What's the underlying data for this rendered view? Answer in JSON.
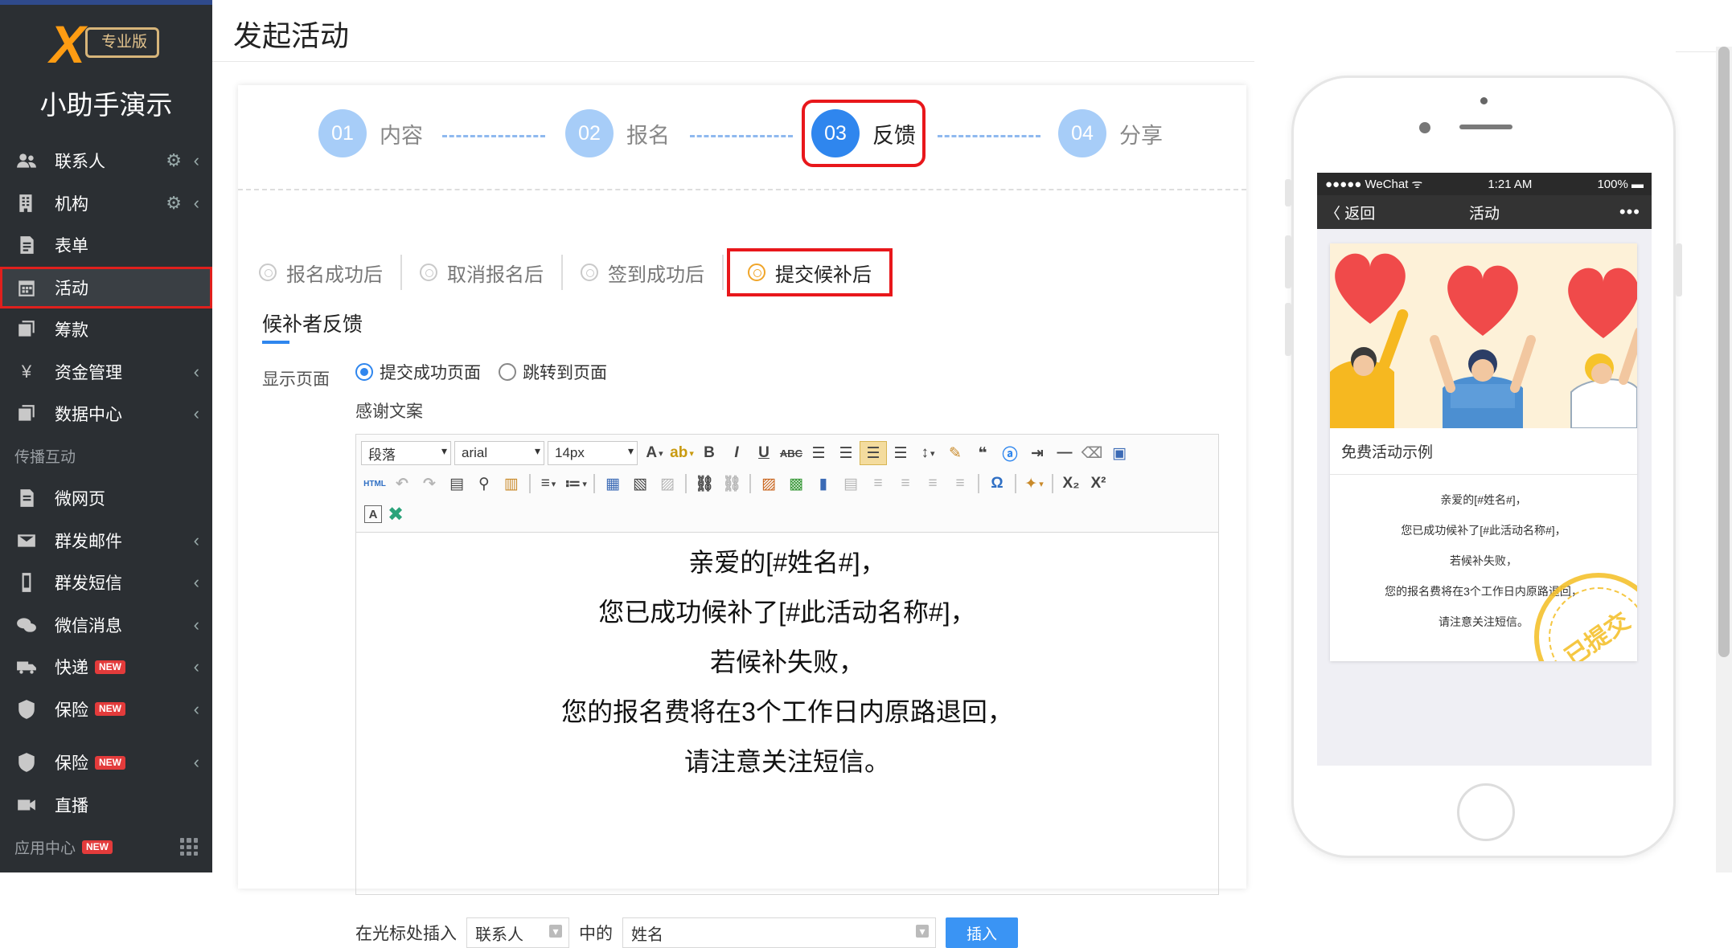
{
  "sidebar": {
    "logo_badge": "专业版",
    "org_name": "小助手演示",
    "items": [
      {
        "label": "联系人",
        "icon": "contacts-icon",
        "gear": true,
        "arrow": true
      },
      {
        "label": "机构",
        "icon": "building-icon",
        "gear": true,
        "arrow": true
      },
      {
        "label": "表单",
        "icon": "form-icon"
      },
      {
        "label": "活动",
        "icon": "calendar-icon",
        "active": true
      },
      {
        "label": "筹款",
        "icon": "fundraise-icon"
      },
      {
        "label": "资金管理",
        "icon": "yen-icon",
        "arrow": true
      },
      {
        "label": "数据中心",
        "icon": "data-icon",
        "arrow": true
      }
    ],
    "section_label": "传播互动",
    "items2": [
      {
        "label": "微网页",
        "icon": "page-icon"
      },
      {
        "label": "群发邮件",
        "icon": "mail-icon",
        "arrow": true
      },
      {
        "label": "群发短信",
        "icon": "phone-icon",
        "arrow": true
      },
      {
        "label": "微信消息",
        "icon": "wechat-icon",
        "arrow": true
      },
      {
        "label": "快递",
        "icon": "truck-icon",
        "new": "NEW",
        "arrow": true
      },
      {
        "label": "保险",
        "icon": "shield-icon",
        "new": "NEW",
        "arrow": true
      },
      {
        "label": "保险",
        "icon": "shield-icon",
        "new": "NEW",
        "arrow": true
      },
      {
        "label": "直播",
        "icon": "video-icon"
      }
    ],
    "app_center": "应用中心",
    "app_center_new": "NEW"
  },
  "page_title": "发起活动",
  "steps": [
    {
      "num": "01",
      "label": "内容"
    },
    {
      "num": "02",
      "label": "报名"
    },
    {
      "num": "03",
      "label": "反馈"
    },
    {
      "num": "04",
      "label": "分享"
    }
  ],
  "subtabs": [
    "报名成功后",
    "取消报名后",
    "签到成功后",
    "提交候补后"
  ],
  "section_title": "候补者反馈",
  "display_label": "显示页面",
  "radio_options": [
    "提交成功页面",
    "跳转到页面"
  ],
  "thanks_label": "感谢文案",
  "editor": {
    "paragraph_select": "段落",
    "font_select": "arial",
    "size_select": "14px",
    "lines": [
      "亲爱的[#姓名#]，",
      "您已成功候补了[#此活动名称#]，",
      "若候补失败，",
      "您的报名费将在3个工作日内原路退回，",
      "请注意关注短信。"
    ]
  },
  "insert": {
    "prefix": "在光标处插入",
    "select1": "联系人",
    "middle": "中的",
    "select2": "姓名",
    "button": "插入"
  },
  "phone": {
    "status_left": "●●●●● WeChat ᯤ",
    "status_time": "1:21 AM",
    "status_right": "100% ▬",
    "back": "〈 返回",
    "nav_title": "活动",
    "more": "•••",
    "card_title": "免费活动示例",
    "lines": [
      "亲爱的[#姓名#]，",
      "您已成功候补了[#此活动名称#]，",
      "若候补失败，",
      "您的报名费将在3个工作日内原路退回，",
      "请注意关注短信。"
    ],
    "stamp": "已提交"
  },
  "colors": {
    "sidebar_bg": "#2b2f33",
    "accent": "#2f86ee",
    "highlight": "#e8171b",
    "stamp": "#f5c12e"
  }
}
